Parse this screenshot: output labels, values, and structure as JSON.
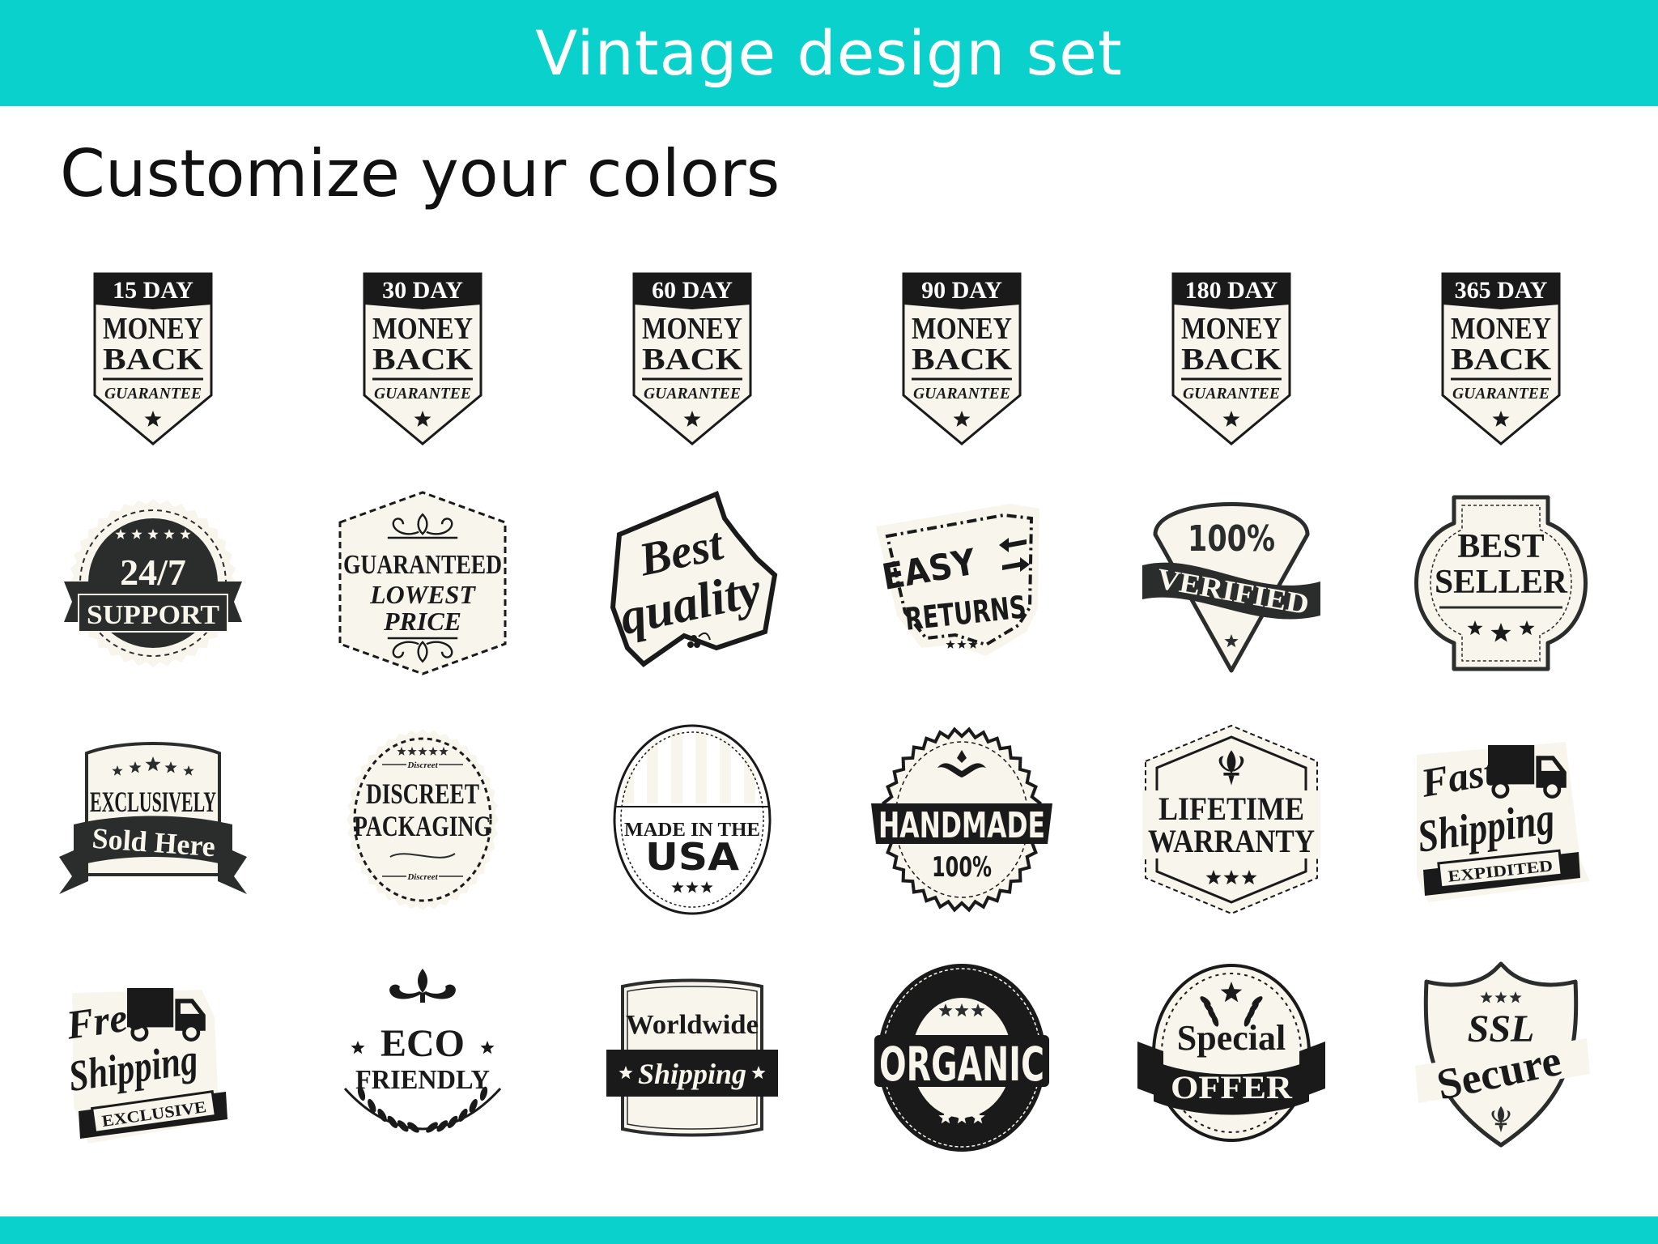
{
  "header": {
    "title": "Vintage design set"
  },
  "subtitle": "Customize your colors",
  "colors": {
    "accent": "#0BD1CD",
    "ink": "#1a1a1a",
    "cream": "#F8F5EC",
    "dark": "#2b2d2d"
  },
  "badges": [
    {
      "type": "money-back",
      "lines": [
        "15 DAY",
        "MONEY",
        "BACK",
        "GUARANTEE"
      ],
      "icon": "star-icon"
    },
    {
      "type": "money-back",
      "lines": [
        "30 DAY",
        "MONEY",
        "BACK",
        "GUARANTEE"
      ],
      "icon": "star-icon"
    },
    {
      "type": "money-back",
      "lines": [
        "60 DAY",
        "MONEY",
        "BACK",
        "GUARANTEE"
      ],
      "icon": "star-icon"
    },
    {
      "type": "money-back",
      "lines": [
        "90 DAY",
        "MONEY",
        "BACK",
        "GUARANTEE"
      ],
      "icon": "star-icon"
    },
    {
      "type": "money-back",
      "lines": [
        "180 DAY",
        "MONEY",
        "BACK",
        "GUARANTEE"
      ],
      "icon": "star-icon"
    },
    {
      "type": "money-back",
      "lines": [
        "365 DAY",
        "MONEY",
        "BACK",
        "GUARANTEE"
      ],
      "icon": "star-icon"
    },
    {
      "type": "support",
      "lines": [
        "24/7",
        "SUPPORT"
      ],
      "icon": "stars-icon"
    },
    {
      "type": "guaranteed",
      "lines": [
        "GUARANTEED",
        "LOWEST",
        "PRICE"
      ],
      "icon": "ornament-icon"
    },
    {
      "type": "best-quality",
      "lines": [
        "Best",
        "quality"
      ],
      "icon": "berry-icon"
    },
    {
      "type": "easy-returns",
      "lines": [
        "EASY",
        "RETURNS"
      ],
      "icon": "arrows-icon"
    },
    {
      "type": "verified",
      "lines": [
        "100%",
        "VERIFIED"
      ],
      "icon": "star-icon"
    },
    {
      "type": "best-seller",
      "lines": [
        "BEST",
        "SELLER"
      ],
      "icon": "stars-icon"
    },
    {
      "type": "exclusively",
      "lines": [
        "EXCLUSIVELY",
        "Sold Here"
      ],
      "icon": "stars-icon"
    },
    {
      "type": "discreet",
      "lines": [
        "Discreet",
        "DISCREET",
        "PACKAGING",
        "Discreet"
      ],
      "icon": "stars-icon"
    },
    {
      "type": "usa",
      "lines": [
        "MADE IN THE",
        "USA"
      ],
      "icon": "stars-icon"
    },
    {
      "type": "handmade",
      "lines": [
        "HANDMADE",
        "100%"
      ],
      "icon": "crown-ornament-icon"
    },
    {
      "type": "lifetime",
      "lines": [
        "LIFETIME",
        "WARRANTY"
      ],
      "icon": "fleur-de-lis-icon"
    },
    {
      "type": "fast-shipping",
      "lines": [
        "Fast",
        "Shipping",
        "EXPIDITED"
      ],
      "icon": "truck-icon"
    },
    {
      "type": "free-shipping",
      "lines": [
        "Free",
        "Shipping",
        "EXCLUSIVE"
      ],
      "icon": "truck-icon"
    },
    {
      "type": "eco",
      "lines": [
        "ECO",
        "FRIENDLY"
      ],
      "icon": "laurel-icon"
    },
    {
      "type": "worldwide",
      "lines": [
        "Worldwide",
        "Shipping"
      ],
      "icon": "stars-icon"
    },
    {
      "type": "organic",
      "lines": [
        "ORGANIC"
      ],
      "icon": "stars-icon"
    },
    {
      "type": "special-offer",
      "lines": [
        "Special",
        "OFFER"
      ],
      "icon": "laurel-star-icon"
    },
    {
      "type": "ssl",
      "lines": [
        "SSL",
        "Secure"
      ],
      "icon": "fleur-de-lis-icon"
    }
  ]
}
